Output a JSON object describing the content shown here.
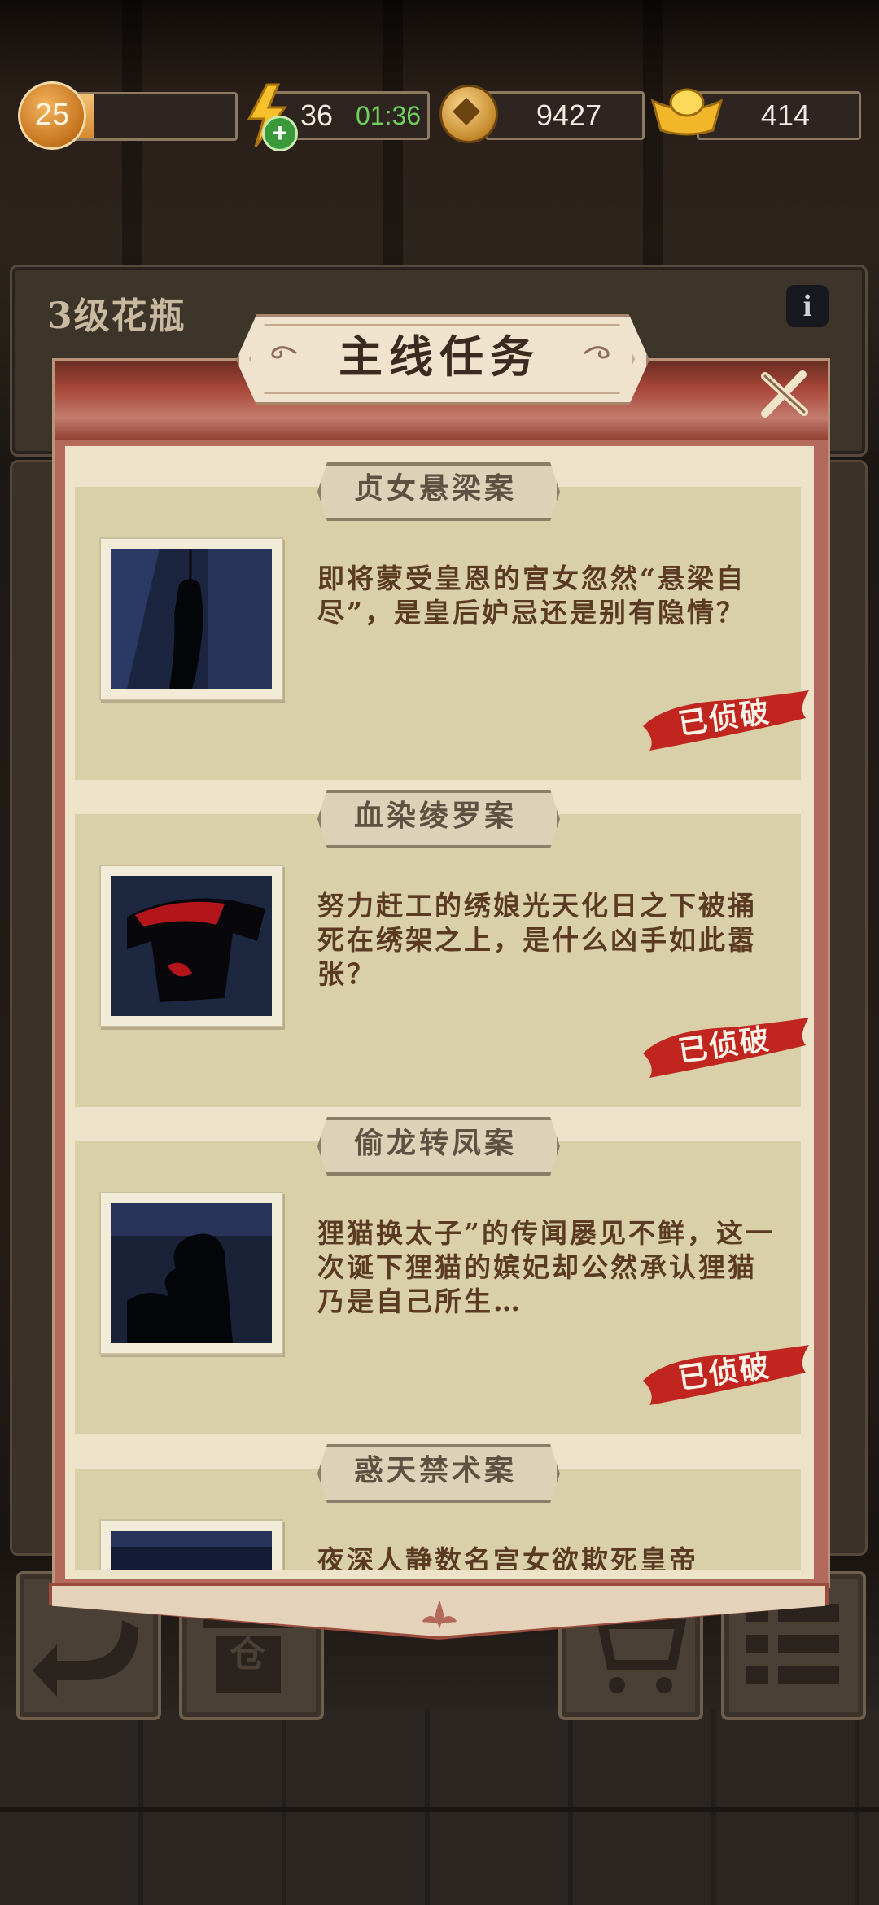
{
  "hud": {
    "level": "25",
    "level_progress": 0.2,
    "energy": "36",
    "energy_timer": "01:36",
    "energy_plus": "+",
    "coins": "9427",
    "gold": "414"
  },
  "background": {
    "item_title": "3级花瓶",
    "info_icon": "i",
    "bottom_icons": [
      "back-arrow-icon",
      "warehouse-icon",
      "cart-icon",
      "list-icon"
    ],
    "warehouse_label": "仓"
  },
  "modal": {
    "title": "主线任务",
    "close_icon": "close-x-icon",
    "ornament": "ornament-icon"
  },
  "quests": [
    {
      "title": "贞女悬梁案",
      "description": "即将蒙受皇恩的宫女忽然“悬梁自尽”，是皇后妒忌还是别有隐情？",
      "status": "已侦破",
      "thumbnail_icon": "hanging-silhouette-icon"
    },
    {
      "title": "血染绫罗案",
      "description": "努力赶工的绣娘光天化日之下被捅死在绣架之上，是什么凶手如此嚣张？",
      "status": "已侦破",
      "thumbnail_icon": "bloody-robe-icon"
    },
    {
      "title": "偷龙转凤案",
      "description": "狸猫换太子”的传闻屡见不鲜，这一次诞下狸猫的嫔妃却公然承认狸猫乃是自己所生…",
      "status": "已侦破",
      "thumbnail_icon": "servant-silhouette-icon"
    },
    {
      "title": "惑天禁术案",
      "description": "夜深人静数名宫女欲欺死皇帝",
      "status": "",
      "thumbnail_icon": "night-scene-icon"
    }
  ],
  "colors": {
    "modal_red": "#a9473a",
    "card_bg": "#d9d0aa",
    "stamp_red": "#c0261f",
    "text_brown": "#5a3a22",
    "timer_green": "#6fd05a"
  }
}
